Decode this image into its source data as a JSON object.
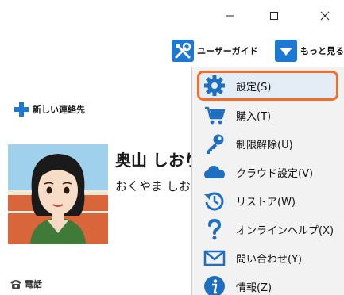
{
  "window": {
    "minimize_glyph": "—",
    "maximize_glyph": "☐",
    "close_glyph": "✕"
  },
  "toolbar": {
    "user_guide_label": "ユーザーガイド",
    "user_guide_icon": "tools-icon",
    "more_label": "もっと見る",
    "more_icon": "chevron-down-icon"
  },
  "contacts": {
    "new_contact_label": "新しい連絡先"
  },
  "contact": {
    "name": "奥山 しおり",
    "reading": "おくやま しおり",
    "phone_label": "電話"
  },
  "menu": {
    "items": [
      {
        "label": "設定(S)",
        "icon": "gear-icon",
        "highlighted": true
      },
      {
        "label": "購入(T)",
        "icon": "cart-icon"
      },
      {
        "label": "制限解除(U)",
        "icon": "key-icon"
      },
      {
        "label": "クラウド設定(V)",
        "icon": "cloud-icon"
      },
      {
        "label": "リストア(W)",
        "icon": "restore-icon"
      },
      {
        "label": "オンラインヘルプ(X)",
        "icon": "question-icon"
      },
      {
        "label": "問い合わせ(Y)",
        "icon": "mail-icon"
      },
      {
        "label": "情報(Z)",
        "icon": "info-icon"
      }
    ]
  },
  "colors": {
    "accent_blue": "#1e78d2",
    "highlight_border": "#f26e2a",
    "menu_background": "#f2f2f2"
  }
}
